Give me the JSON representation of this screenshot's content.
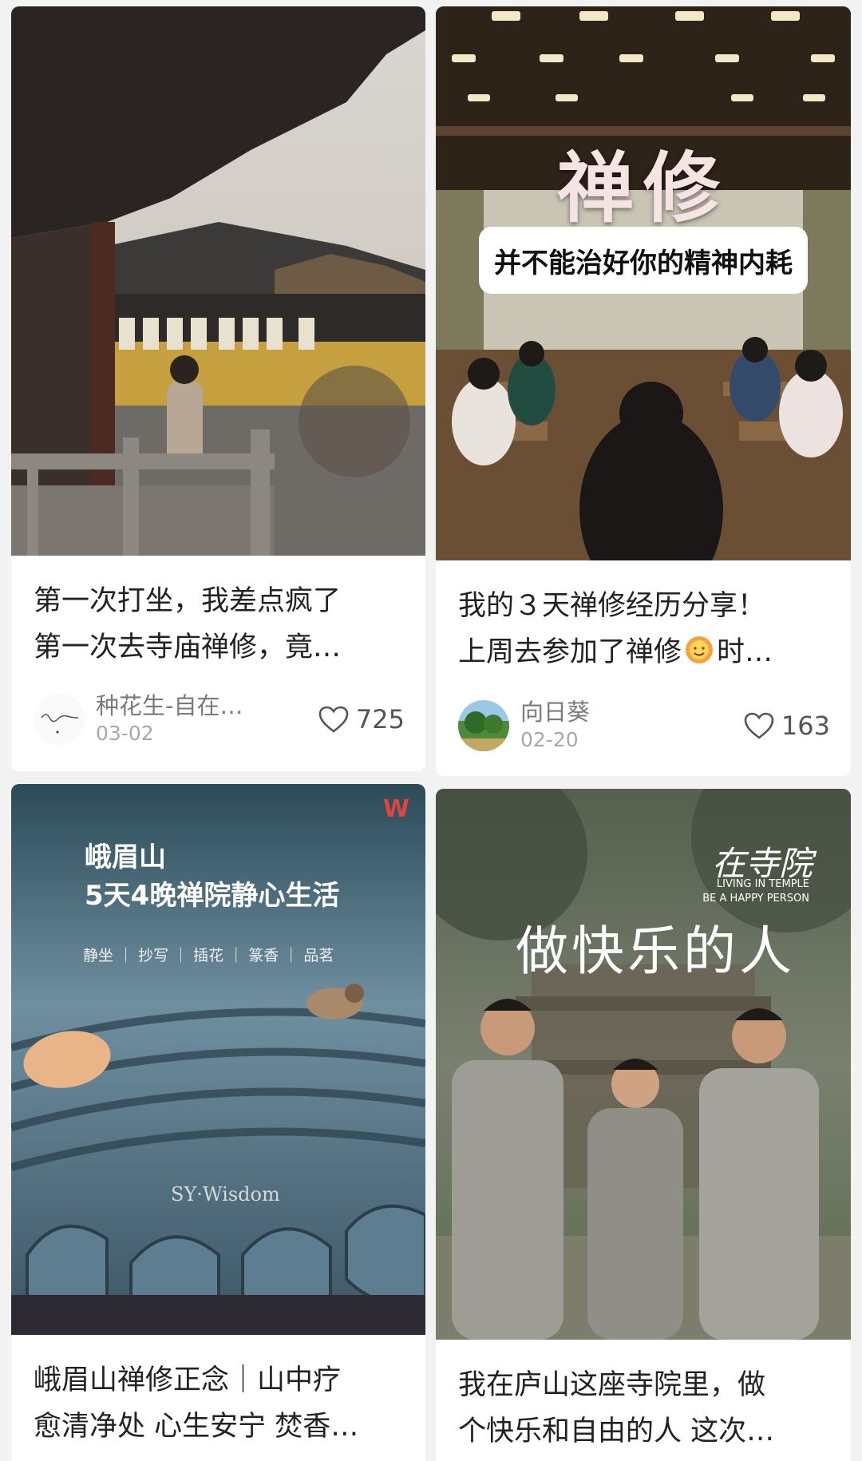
{
  "feed": {
    "cards": [
      {
        "title_line1": "第一次打坐，我差点疯了",
        "title_line2": "第一次去寺庙禅修，竟…",
        "author": "种花生-自在…",
        "date": "03-02",
        "likes": "725"
      },
      {
        "cover_big_text": "禅修",
        "cover_subtitle": "并不能治好你的精神内耗",
        "title_line1": "我的３天禅修经历分享！",
        "title_line2": "上周去参加了禅修",
        "title_line2_end": "时…",
        "author": "向日葵",
        "date": "02-20",
        "likes": "163"
      },
      {
        "cover_logo": "W",
        "cover_line1": "峨眉山",
        "cover_line2": "5天4晚禅院静心生活",
        "cover_tags": "静坐 ｜ 抄写 ｜ 插花 ｜ 篆香 ｜ 品茗",
        "cover_watermark": "SY·Wisdom",
        "title_line1": "峨眉山禅修正念｜山中疗",
        "title_line2": "愈清净处 心生安宁 焚香…"
      },
      {
        "cover_script": "在寺院",
        "cover_en1": "LIVING IN TEMPLE",
        "cover_en2": "BE A HAPPY PERSON",
        "cover_big": "做快乐的人",
        "title_line1": "我在庐山这座寺院里，做",
        "title_line2": "个快乐和自由的人 这次…"
      }
    ]
  },
  "colors": {
    "background": "#f2f2f2",
    "card": "#ffffff",
    "secondary_text": "#7a7a7a"
  }
}
